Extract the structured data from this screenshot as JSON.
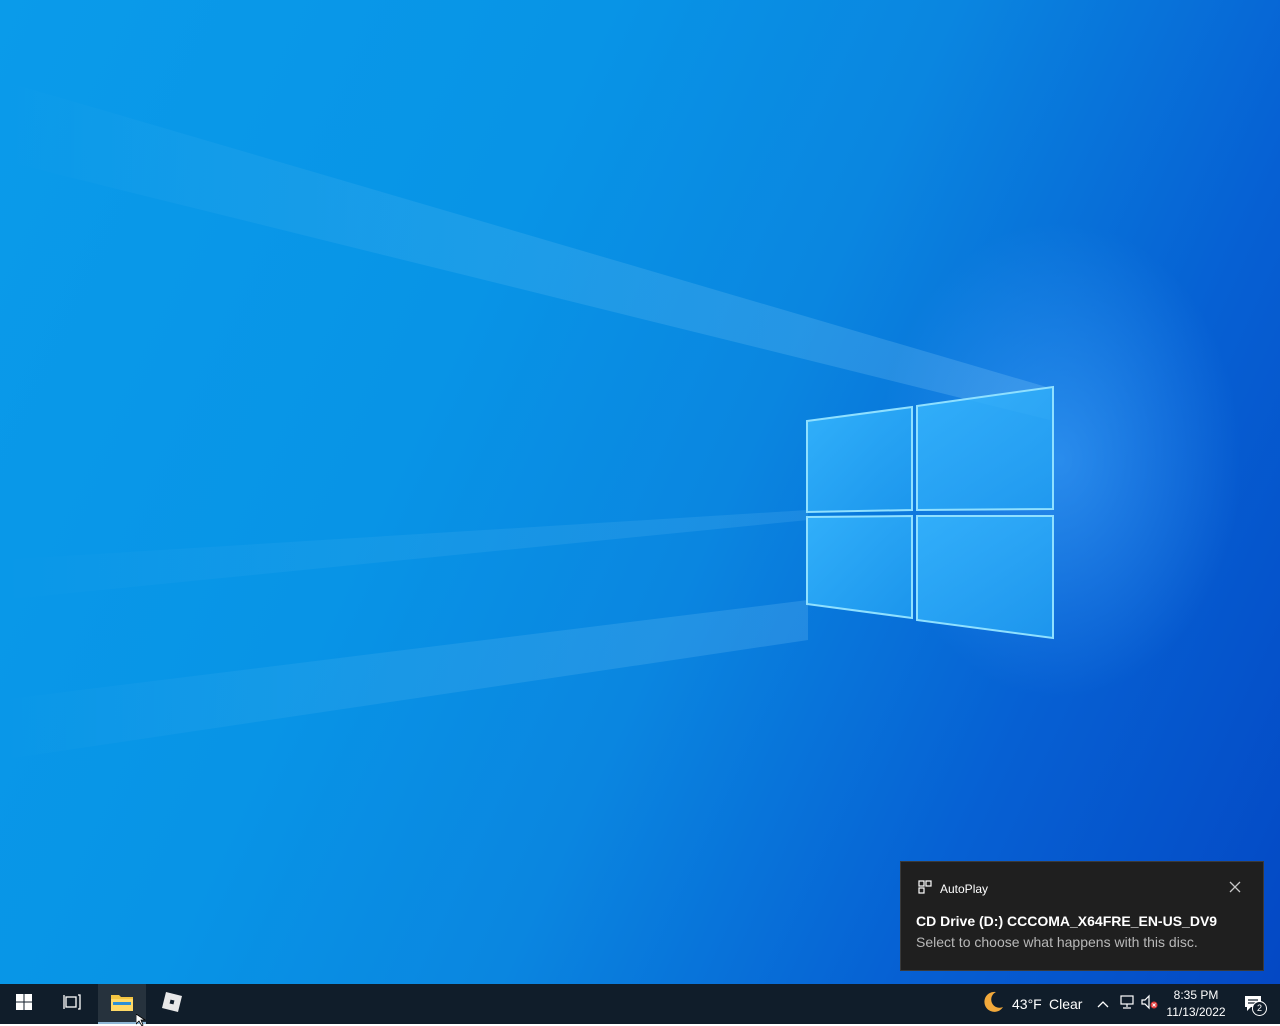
{
  "colors": {
    "taskbar": "#101d2a",
    "toast_bg": "#1f1f1f",
    "wallpaper_light": "#0a9bea",
    "wallpaper_dark": "#0448c4"
  },
  "desktop": {
    "wallpaper": "windows-10-hero"
  },
  "notification": {
    "app_icon": "autoplay-icon",
    "app_name": "AutoPlay",
    "title": "CD Drive (D:) CCCOMA_X64FRE_EN-US_DV9",
    "body": "Select to choose what happens with this disc.",
    "close_icon": "close-icon"
  },
  "taskbar": {
    "start_icon": "windows-start-icon",
    "task_view_icon": "task-view-icon",
    "pinned": [
      {
        "name": "File Explorer",
        "icon": "file-explorer-icon",
        "active": true
      },
      {
        "name": "Roblox",
        "icon": "roblox-icon",
        "active": false
      }
    ],
    "weather": {
      "icon": "moon-icon",
      "temperature": "43°F",
      "condition": "Clear"
    },
    "tray": {
      "chevron_icon": "chevron-up-icon",
      "network_icon": "network-icon",
      "volume_icon": "volume-muted-icon"
    },
    "clock": {
      "time": "8:35 PM",
      "date": "11/13/2022"
    },
    "action_center": {
      "icon": "notification-icon",
      "count": "2"
    }
  }
}
